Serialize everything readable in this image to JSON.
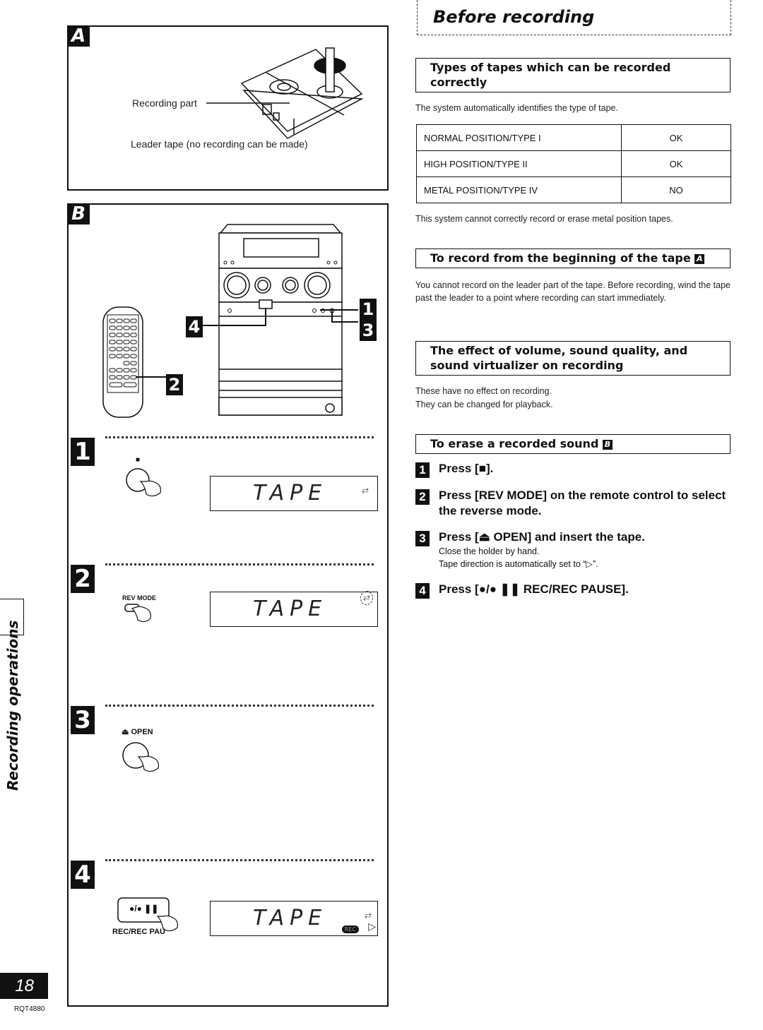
{
  "page": {
    "title": "Before recording",
    "section_tab": "Recording operations",
    "page_number": "18",
    "doc_code": "RQT4880"
  },
  "panel_a": {
    "letter": "A",
    "caption_recording_part": "Recording part",
    "caption_leader_tape": "Leader tape (no recording can be made)"
  },
  "panel_b": {
    "letter": "B",
    "callouts": [
      "1",
      "2",
      "3",
      "4"
    ],
    "steps": [
      {
        "num": "1",
        "button_label": "■",
        "display_text": "TAPE",
        "display_indicator": "⇄"
      },
      {
        "num": "2",
        "button_label": "REV MODE",
        "display_text": "TAPE",
        "display_indicator": "⇄"
      },
      {
        "num": "3",
        "button_label": "⏏ OPEN"
      },
      {
        "num": "4",
        "button_label": "●/● ❚❚",
        "button_caption": "REC/REC PAU",
        "display_text": "TAPE",
        "display_indicator": "⇄",
        "display_direction": "▷",
        "display_badge": "REC"
      }
    ]
  },
  "sections": {
    "types": {
      "heading": "Types of tapes which can be recorded correctly",
      "intro": "The system automatically identifies the type of tape.",
      "table": [
        {
          "type": "NORMAL POSITION/TYPE I",
          "status": "OK"
        },
        {
          "type": "HIGH POSITION/TYPE II",
          "status": "OK"
        },
        {
          "type": "METAL POSITION/TYPE IV",
          "status": "NO"
        }
      ],
      "note": "This system cannot correctly record or erase metal position tapes."
    },
    "beginning": {
      "heading": "To record from the beginning of the tape",
      "ref": "A",
      "body": "You cannot record on the leader part of the tape. Before recording, wind the tape past the leader to a point where recording can start immediately."
    },
    "effect": {
      "heading": "The effect of volume, sound quality, and sound virtualizer on recording",
      "line1": "These have no effect on recording.",
      "line2": "They can be changed for playback."
    },
    "erase": {
      "heading": "To erase a recorded sound",
      "ref": "B",
      "steps": [
        {
          "num": "1",
          "text": "Press [■]."
        },
        {
          "num": "2",
          "text": "Press [REV MODE] on the remote control to select the reverse mode."
        },
        {
          "num": "3",
          "text": "Press [⏏ OPEN] and insert the tape.",
          "sub1": "Close the holder by hand.",
          "sub2": "Tape direction is automatically set to “▷”."
        },
        {
          "num": "4",
          "text": "Press [●/● ❚❚ REC/REC PAUSE]."
        }
      ]
    }
  }
}
